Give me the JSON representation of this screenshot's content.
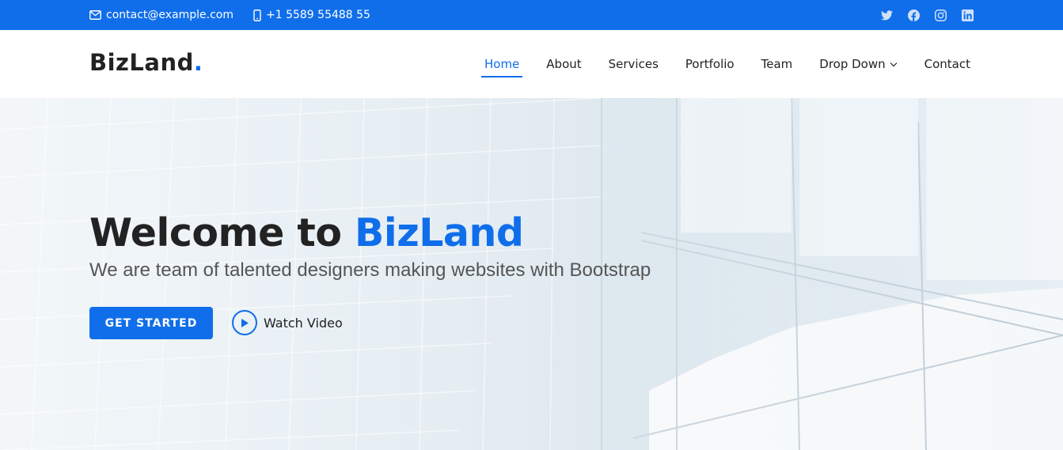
{
  "topbar": {
    "email": "contact@example.com",
    "phone": "+1 5589 55488 55",
    "social": [
      "twitter-icon",
      "facebook-icon",
      "instagram-icon",
      "linkedin-icon"
    ],
    "background": "#106eea"
  },
  "header": {
    "logo": "BizLand",
    "logo_dot": ".",
    "nav": [
      {
        "label": "Home",
        "active": true
      },
      {
        "label": "About",
        "active": false
      },
      {
        "label": "Services",
        "active": false
      },
      {
        "label": "Portfolio",
        "active": false
      },
      {
        "label": "Team",
        "active": false
      },
      {
        "label": "Drop Down",
        "active": false,
        "dropdown": true
      },
      {
        "label": "Contact",
        "active": false
      }
    ]
  },
  "hero": {
    "title_prefix": "Welcome to ",
    "title_accent": "BizLand",
    "subtitle": "We are team of talented designers making websites with Bootstrap",
    "cta_label": "GET STARTED",
    "video_label": "Watch Video"
  },
  "colors": {
    "accent": "#106eea",
    "text": "#222222",
    "subtext": "#555555"
  }
}
